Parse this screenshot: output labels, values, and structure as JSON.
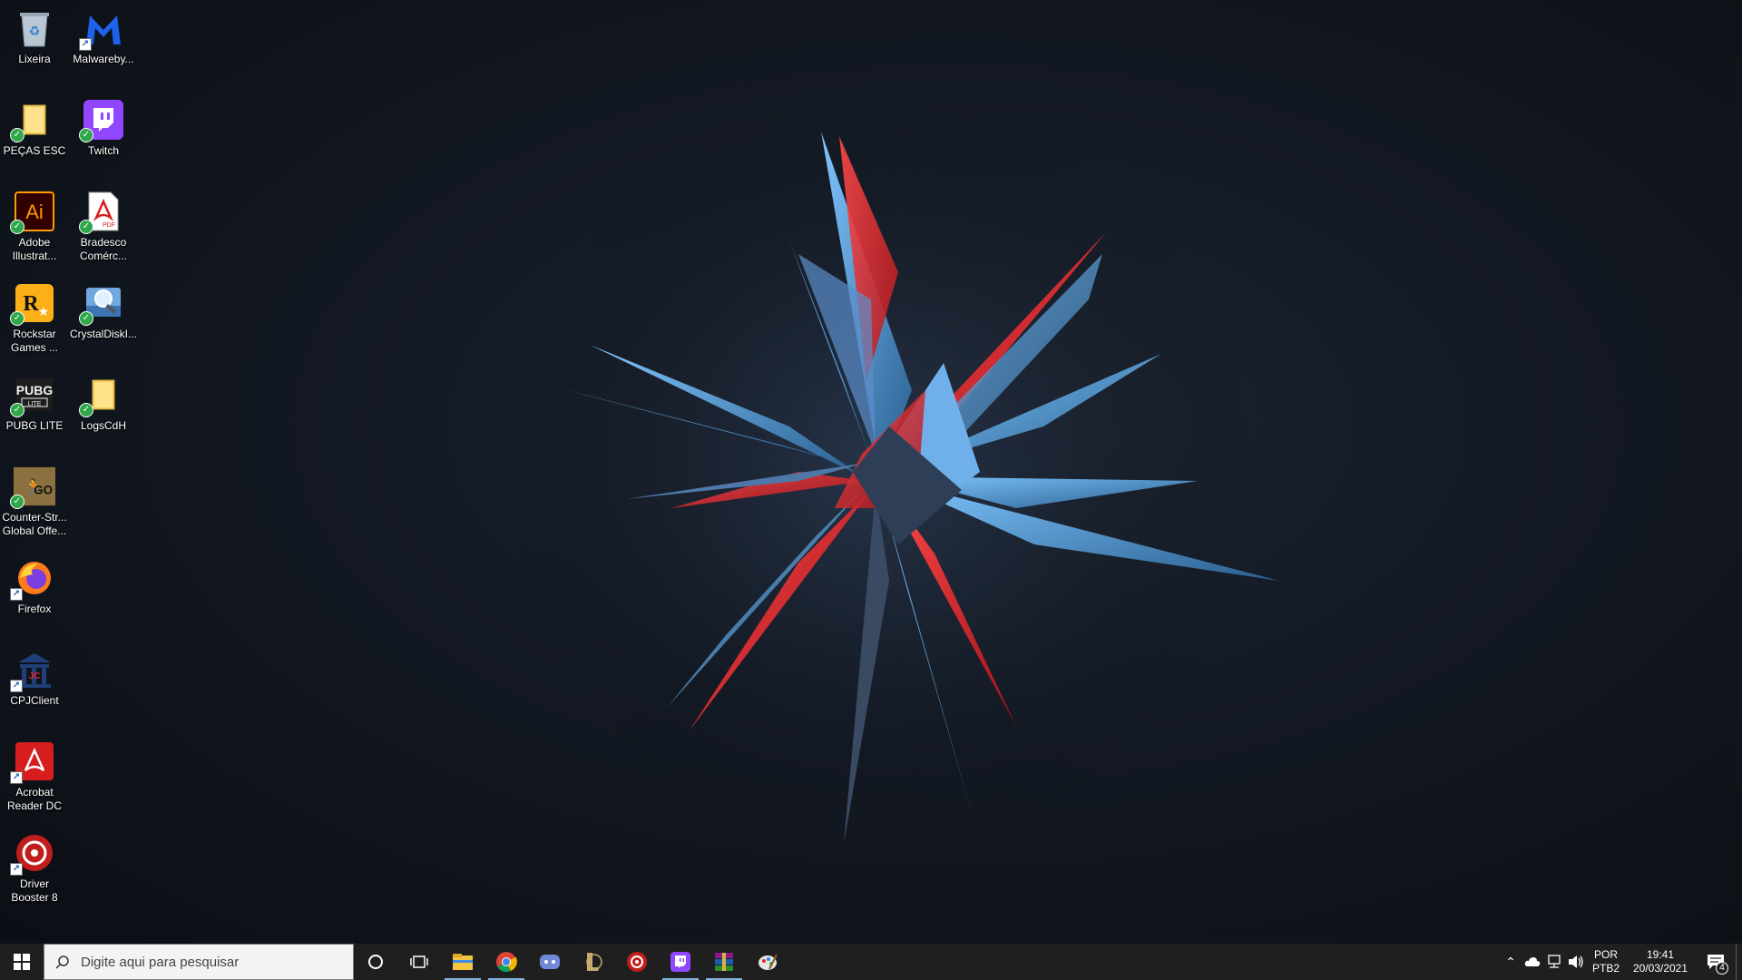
{
  "desktop": {
    "icons": [
      {
        "label": "Lixeira",
        "icon": "recycle-bin-icon"
      },
      {
        "label": "Malwareby...",
        "icon": "malwarebytes-icon"
      },
      {
        "label": "PEÇAS ESC",
        "icon": "folder-icon"
      },
      {
        "label": "Twitch",
        "icon": "twitch-icon"
      },
      {
        "label": "Adobe\nIllustrat...",
        "icon": "adobe-illustrator-icon"
      },
      {
        "label": "Bradesco\nComérc...",
        "icon": "pdf-file-icon"
      },
      {
        "label": "Rockstar\nGames ...",
        "icon": "rockstar-games-icon"
      },
      {
        "label": "CrystalDiskI...",
        "icon": "crystaldiskinfo-icon"
      },
      {
        "label": "PUBG LITE",
        "icon": "pubg-lite-icon"
      },
      {
        "label": "LogsCdH",
        "icon": "folder-icon"
      },
      {
        "label": "Counter-Str...\nGlobal Offe...",
        "icon": "csgo-icon"
      },
      {
        "label": "Firefox",
        "icon": "firefox-icon"
      },
      {
        "label": "CPJClient",
        "icon": "cpjclient-icon"
      },
      {
        "label": "Acrobat\nReader DC",
        "icon": "acrobat-reader-icon"
      },
      {
        "label": "Driver\nBooster 8",
        "icon": "driver-booster-icon"
      }
    ]
  },
  "taskbar": {
    "search_placeholder": "Digite aqui para pesquisar",
    "pinned": [
      {
        "icon": "file-explorer-icon",
        "active": true
      },
      {
        "icon": "chrome-icon",
        "active": true
      },
      {
        "icon": "discord-icon",
        "active": false
      },
      {
        "icon": "league-of-legends-icon",
        "active": false
      },
      {
        "icon": "driver-booster-icon",
        "active": false
      },
      {
        "icon": "twitch-icon",
        "active": true
      },
      {
        "icon": "winrar-icon",
        "active": true
      },
      {
        "icon": "paint-icon",
        "active": false
      }
    ],
    "tray": {
      "lang_top": "POR",
      "lang_bottom": "PTB2",
      "time": "19:41",
      "date": "20/03/2021",
      "notifications": "4"
    }
  },
  "colors": {
    "taskbar_bg": "#1f1f1f",
    "accent_blue": "#3d8fd6",
    "accent_red": "#e8262b"
  }
}
